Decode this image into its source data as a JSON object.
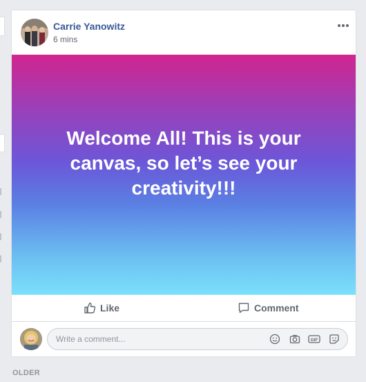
{
  "post": {
    "author": "Carrie Yanowitz",
    "timestamp": "6 mins",
    "canvas_text": "Welcome All! This is your canvas, so let’s see your creativity!!!",
    "canvas_gradient": [
      "#d0258f",
      "#6b57d9",
      "#7be0fb"
    ]
  },
  "actions": {
    "like_label": "Like",
    "comment_label": "Comment"
  },
  "comment_input": {
    "placeholder": "Write a comment..."
  },
  "feed": {
    "older_label": "OLDER"
  },
  "colors": {
    "author_link": "#385898",
    "action_text": "#606770"
  },
  "icons": [
    "more-options-icon",
    "like-icon",
    "comment-icon",
    "emoji-icon",
    "camera-icon",
    "gif-icon",
    "sticker-icon"
  ]
}
